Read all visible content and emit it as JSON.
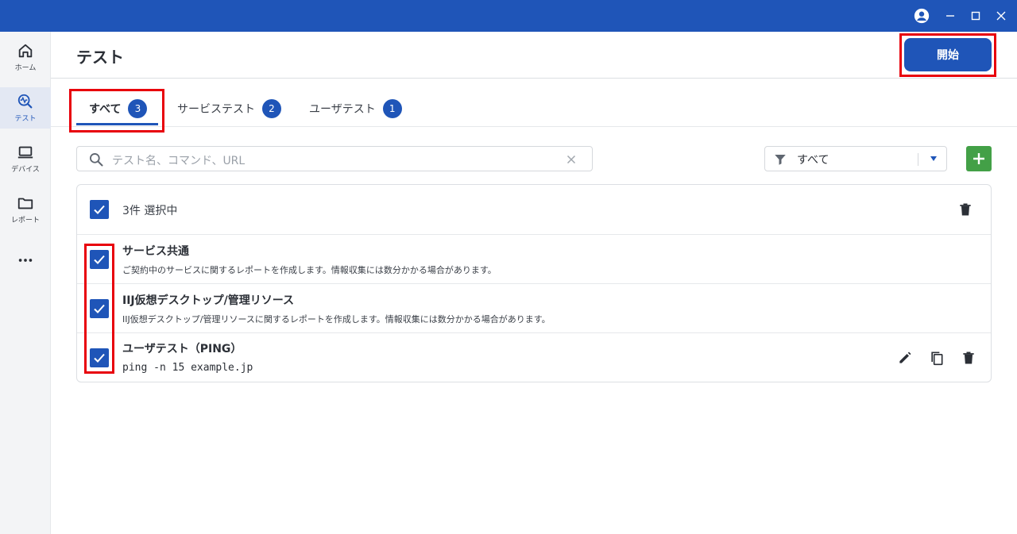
{
  "window": {
    "accent": "#1f55b8",
    "highlight": "#e8000b"
  },
  "sidebar": {
    "items": [
      {
        "label": "ホーム",
        "icon": "home-icon"
      },
      {
        "label": "テスト",
        "icon": "test-icon",
        "active": true
      },
      {
        "label": "デバイス",
        "icon": "laptop-icon"
      },
      {
        "label": "レポート",
        "icon": "folder-icon"
      }
    ],
    "more_icon": "more-horizontal-icon"
  },
  "header": {
    "title": "テスト",
    "start_label": "開始"
  },
  "tabs": [
    {
      "label": "すべて",
      "count": "3",
      "active": true
    },
    {
      "label": "サービステスト",
      "count": "2"
    },
    {
      "label": "ユーザテスト",
      "count": "1"
    }
  ],
  "search": {
    "placeholder": "テスト名、コマンド、URL"
  },
  "filter": {
    "selected": "すべて"
  },
  "list": {
    "selection_text": "3件 選択中",
    "items": [
      {
        "title": "サービス共通",
        "description": "ご契約中のサービスに関するレポートを作成します。情報収集には数分かかる場合があります。",
        "checked": true
      },
      {
        "title": "IIJ仮想デスクトップ/管理リソース",
        "description": "IIJ仮想デスクトップ/管理リソースに関するレポートを作成します。情報収集には数分かかる場合があります。",
        "checked": true
      },
      {
        "title": "ユーザテスト（PING）",
        "command": "ping -n 15 example.jp",
        "checked": true
      }
    ]
  }
}
